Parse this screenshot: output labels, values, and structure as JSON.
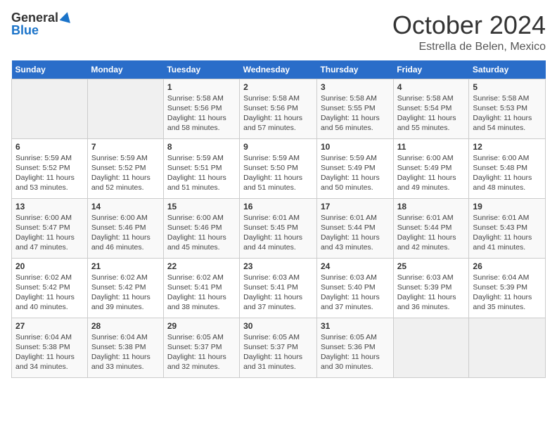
{
  "header": {
    "logo_general": "General",
    "logo_blue": "Blue",
    "month_title": "October 2024",
    "location": "Estrella de Belen, Mexico"
  },
  "days_of_week": [
    "Sunday",
    "Monday",
    "Tuesday",
    "Wednesday",
    "Thursday",
    "Friday",
    "Saturday"
  ],
  "weeks": [
    [
      {
        "day": "",
        "detail": ""
      },
      {
        "day": "",
        "detail": ""
      },
      {
        "day": "1",
        "detail": "Sunrise: 5:58 AM\nSunset: 5:56 PM\nDaylight: 11 hours\nand 58 minutes."
      },
      {
        "day": "2",
        "detail": "Sunrise: 5:58 AM\nSunset: 5:56 PM\nDaylight: 11 hours\nand 57 minutes."
      },
      {
        "day": "3",
        "detail": "Sunrise: 5:58 AM\nSunset: 5:55 PM\nDaylight: 11 hours\nand 56 minutes."
      },
      {
        "day": "4",
        "detail": "Sunrise: 5:58 AM\nSunset: 5:54 PM\nDaylight: 11 hours\nand 55 minutes."
      },
      {
        "day": "5",
        "detail": "Sunrise: 5:58 AM\nSunset: 5:53 PM\nDaylight: 11 hours\nand 54 minutes."
      }
    ],
    [
      {
        "day": "6",
        "detail": "Sunrise: 5:59 AM\nSunset: 5:52 PM\nDaylight: 11 hours\nand 53 minutes."
      },
      {
        "day": "7",
        "detail": "Sunrise: 5:59 AM\nSunset: 5:52 PM\nDaylight: 11 hours\nand 52 minutes."
      },
      {
        "day": "8",
        "detail": "Sunrise: 5:59 AM\nSunset: 5:51 PM\nDaylight: 11 hours\nand 51 minutes."
      },
      {
        "day": "9",
        "detail": "Sunrise: 5:59 AM\nSunset: 5:50 PM\nDaylight: 11 hours\nand 51 minutes."
      },
      {
        "day": "10",
        "detail": "Sunrise: 5:59 AM\nSunset: 5:49 PM\nDaylight: 11 hours\nand 50 minutes."
      },
      {
        "day": "11",
        "detail": "Sunrise: 6:00 AM\nSunset: 5:49 PM\nDaylight: 11 hours\nand 49 minutes."
      },
      {
        "day": "12",
        "detail": "Sunrise: 6:00 AM\nSunset: 5:48 PM\nDaylight: 11 hours\nand 48 minutes."
      }
    ],
    [
      {
        "day": "13",
        "detail": "Sunrise: 6:00 AM\nSunset: 5:47 PM\nDaylight: 11 hours\nand 47 minutes."
      },
      {
        "day": "14",
        "detail": "Sunrise: 6:00 AM\nSunset: 5:46 PM\nDaylight: 11 hours\nand 46 minutes."
      },
      {
        "day": "15",
        "detail": "Sunrise: 6:00 AM\nSunset: 5:46 PM\nDaylight: 11 hours\nand 45 minutes."
      },
      {
        "day": "16",
        "detail": "Sunrise: 6:01 AM\nSunset: 5:45 PM\nDaylight: 11 hours\nand 44 minutes."
      },
      {
        "day": "17",
        "detail": "Sunrise: 6:01 AM\nSunset: 5:44 PM\nDaylight: 11 hours\nand 43 minutes."
      },
      {
        "day": "18",
        "detail": "Sunrise: 6:01 AM\nSunset: 5:44 PM\nDaylight: 11 hours\nand 42 minutes."
      },
      {
        "day": "19",
        "detail": "Sunrise: 6:01 AM\nSunset: 5:43 PM\nDaylight: 11 hours\nand 41 minutes."
      }
    ],
    [
      {
        "day": "20",
        "detail": "Sunrise: 6:02 AM\nSunset: 5:42 PM\nDaylight: 11 hours\nand 40 minutes."
      },
      {
        "day": "21",
        "detail": "Sunrise: 6:02 AM\nSunset: 5:42 PM\nDaylight: 11 hours\nand 39 minutes."
      },
      {
        "day": "22",
        "detail": "Sunrise: 6:02 AM\nSunset: 5:41 PM\nDaylight: 11 hours\nand 38 minutes."
      },
      {
        "day": "23",
        "detail": "Sunrise: 6:03 AM\nSunset: 5:41 PM\nDaylight: 11 hours\nand 37 minutes."
      },
      {
        "day": "24",
        "detail": "Sunrise: 6:03 AM\nSunset: 5:40 PM\nDaylight: 11 hours\nand 37 minutes."
      },
      {
        "day": "25",
        "detail": "Sunrise: 6:03 AM\nSunset: 5:39 PM\nDaylight: 11 hours\nand 36 minutes."
      },
      {
        "day": "26",
        "detail": "Sunrise: 6:04 AM\nSunset: 5:39 PM\nDaylight: 11 hours\nand 35 minutes."
      }
    ],
    [
      {
        "day": "27",
        "detail": "Sunrise: 6:04 AM\nSunset: 5:38 PM\nDaylight: 11 hours\nand 34 minutes."
      },
      {
        "day": "28",
        "detail": "Sunrise: 6:04 AM\nSunset: 5:38 PM\nDaylight: 11 hours\nand 33 minutes."
      },
      {
        "day": "29",
        "detail": "Sunrise: 6:05 AM\nSunset: 5:37 PM\nDaylight: 11 hours\nand 32 minutes."
      },
      {
        "day": "30",
        "detail": "Sunrise: 6:05 AM\nSunset: 5:37 PM\nDaylight: 11 hours\nand 31 minutes."
      },
      {
        "day": "31",
        "detail": "Sunrise: 6:05 AM\nSunset: 5:36 PM\nDaylight: 11 hours\nand 30 minutes."
      },
      {
        "day": "",
        "detail": ""
      },
      {
        "day": "",
        "detail": ""
      }
    ]
  ]
}
